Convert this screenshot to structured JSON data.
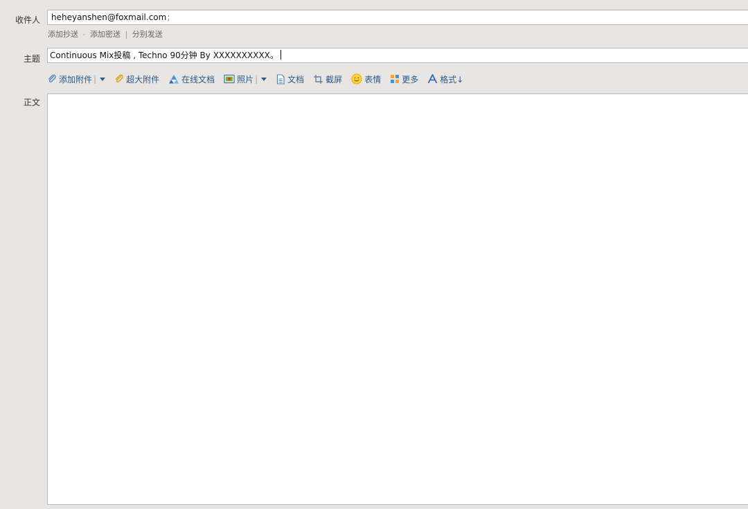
{
  "recipients": {
    "label": "收件人",
    "value": "heheyanshen@foxmail.com",
    "separator": ";"
  },
  "recipient_links": {
    "add_cc": "添加抄送",
    "dash": "-",
    "add_bcc": "添加密送",
    "pipe": "|",
    "send_separately": "分别发送"
  },
  "subject": {
    "label": "主题",
    "value": "Continuous Mix投稿 , Techno 90分钟 By XXXXXXXXXX。"
  },
  "toolbar": {
    "attachment": "添加附件",
    "large_attachment": "超大附件",
    "online_doc": "在线文档",
    "photo": "照片",
    "document": "文档",
    "screenshot": "截屏",
    "emoticon": "表情",
    "more": "更多",
    "format": "格式↓",
    "pipe": "|"
  },
  "body": {
    "label": "正文",
    "value": ""
  },
  "colors": {
    "background": "#e8e5e2",
    "link": "#2a5b8a",
    "border": "#b9b9b9"
  }
}
